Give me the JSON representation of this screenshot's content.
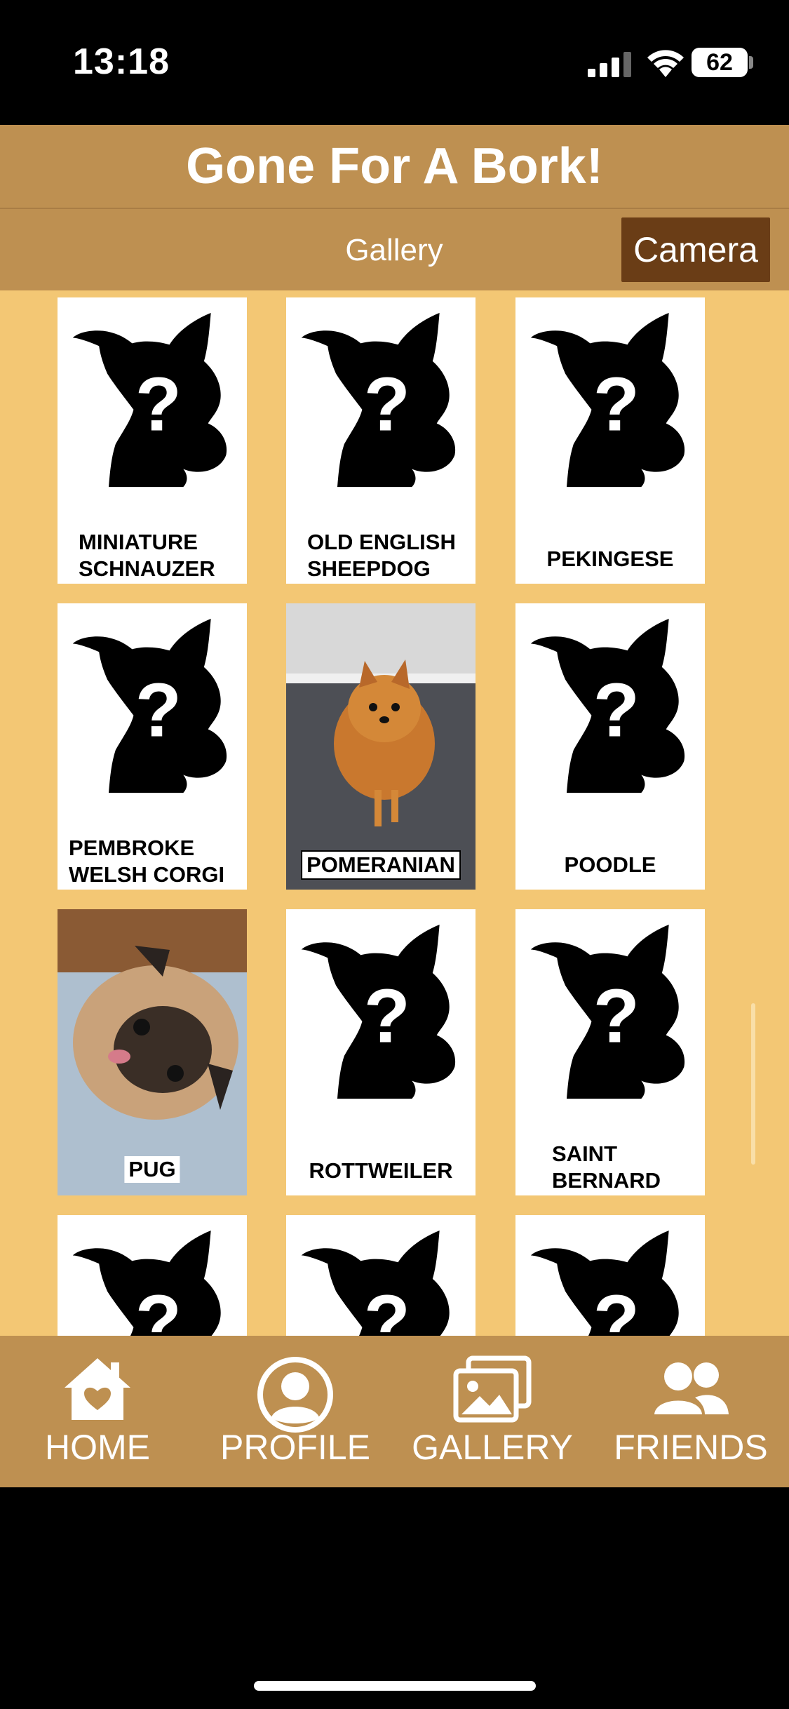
{
  "status_bar": {
    "time": "13:18",
    "battery": "62"
  },
  "header": {
    "title": "Gone For A Bork!"
  },
  "tabs": {
    "gallery": "Gallery",
    "camera": "Camera"
  },
  "gallery": {
    "cards": [
      {
        "label": "MINIATURE\nSCHNAUZER",
        "unlocked": false
      },
      {
        "label": "OLD ENGLISH\nSHEEPDOG",
        "unlocked": false
      },
      {
        "label": "PEKINGESE",
        "unlocked": false
      },
      {
        "label": "PEMBROKE\nWELSH CORGI",
        "unlocked": false
      },
      {
        "label": "POMERANIAN",
        "unlocked": true
      },
      {
        "label": "POODLE",
        "unlocked": false
      },
      {
        "label": "PUG",
        "unlocked": true
      },
      {
        "label": "ROTTWEILER",
        "unlocked": false
      },
      {
        "label": "SAINT\nBERNARD",
        "unlocked": false
      }
    ]
  },
  "nav": {
    "home": "HOME",
    "profile": "PROFILE",
    "gallery": "GALLERY",
    "friends": "FRIENDS"
  },
  "colors": {
    "header_bg": "#BE9051",
    "gallery_bg": "#F3C774",
    "camera_button_bg": "#6A3D16"
  }
}
